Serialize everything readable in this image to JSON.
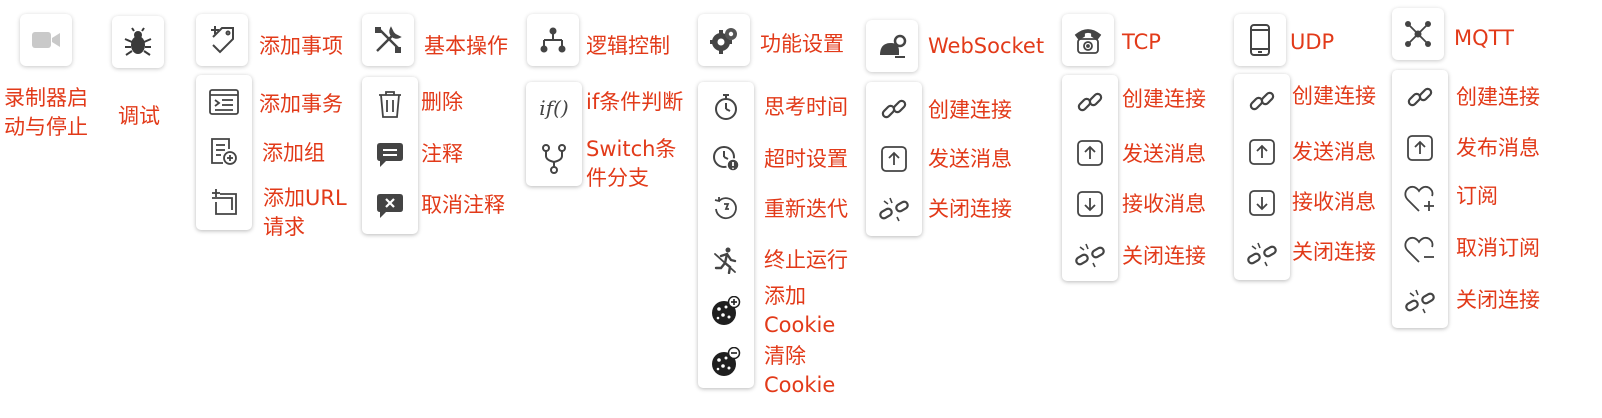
{
  "accent_color": "#e23a19",
  "icon_color": "#444444",
  "toolbar": {
    "recorder": {
      "icon": "video-camera-icon",
      "label": "录制器启动与停止"
    },
    "debug": {
      "icon": "bug-icon",
      "label": "调试"
    },
    "add_item": {
      "icon": "add-tag-icon",
      "label": "添加事项",
      "items": [
        {
          "icon": "transaction-icon",
          "label": "添加事务"
        },
        {
          "icon": "add-group-icon",
          "label": "添加组"
        },
        {
          "icon": "add-url-request-icon",
          "label": "添加URL请求"
        }
      ]
    },
    "basic_ops": {
      "icon": "tools-icon",
      "label": "基本操作",
      "items": [
        {
          "icon": "trash-icon",
          "label": "删除"
        },
        {
          "icon": "comment-icon",
          "label": "注释"
        },
        {
          "icon": "uncomment-icon",
          "label": "取消注释"
        }
      ]
    },
    "logic": {
      "icon": "hierarchy-icon",
      "label": "逻辑控制",
      "items": [
        {
          "icon": "if-function-icon",
          "icon_text": "if()",
          "label": "if条件判断"
        },
        {
          "icon": "branch-icon",
          "label": "Switch条件分支"
        }
      ]
    },
    "settings": {
      "icon": "gears-icon",
      "label": "功能设置",
      "items": [
        {
          "icon": "stopwatch-icon",
          "label": "思考时间"
        },
        {
          "icon": "timeout-clock-icon",
          "label": "超时设置"
        },
        {
          "icon": "restart-icon",
          "label": "重新迭代"
        },
        {
          "icon": "stop-running-icon",
          "label": "终止运行"
        },
        {
          "icon": "add-cookie-icon",
          "label": "添加Cookie"
        },
        {
          "icon": "clear-cookie-icon",
          "label": "清除Cookie"
        }
      ]
    },
    "websocket": {
      "icon": "websocket-icon",
      "label": "WebSocket",
      "items": [
        {
          "icon": "link-icon",
          "label": "创建连接"
        },
        {
          "icon": "upload-box-icon",
          "label": "发送消息"
        },
        {
          "icon": "broken-link-icon",
          "label": "关闭连接"
        }
      ]
    },
    "tcp": {
      "icon": "telephone-icon",
      "label": "TCP",
      "items": [
        {
          "icon": "link-icon",
          "label": "创建连接"
        },
        {
          "icon": "upload-box-icon",
          "label": "发送消息"
        },
        {
          "icon": "download-box-icon",
          "label": "接收消息"
        },
        {
          "icon": "broken-link-icon",
          "label": "关闭连接"
        }
      ]
    },
    "udp": {
      "icon": "mobile-phone-icon",
      "label": "UDP",
      "items": [
        {
          "icon": "link-icon",
          "label": "创建连接"
        },
        {
          "icon": "upload-box-icon",
          "label": "发送消息"
        },
        {
          "icon": "download-box-icon",
          "label": "接收消息"
        },
        {
          "icon": "broken-link-icon",
          "label": "关闭连接"
        }
      ]
    },
    "mqtt": {
      "icon": "mqtt-network-icon",
      "label": "MQTT",
      "items": [
        {
          "icon": "link-icon",
          "label": "创建连接"
        },
        {
          "icon": "upload-box-icon",
          "label": "发布消息"
        },
        {
          "icon": "heart-add-icon",
          "label": "订阅"
        },
        {
          "icon": "heart-remove-icon",
          "label": "取消订阅"
        },
        {
          "icon": "broken-link-icon",
          "label": "关闭连接"
        }
      ]
    }
  }
}
